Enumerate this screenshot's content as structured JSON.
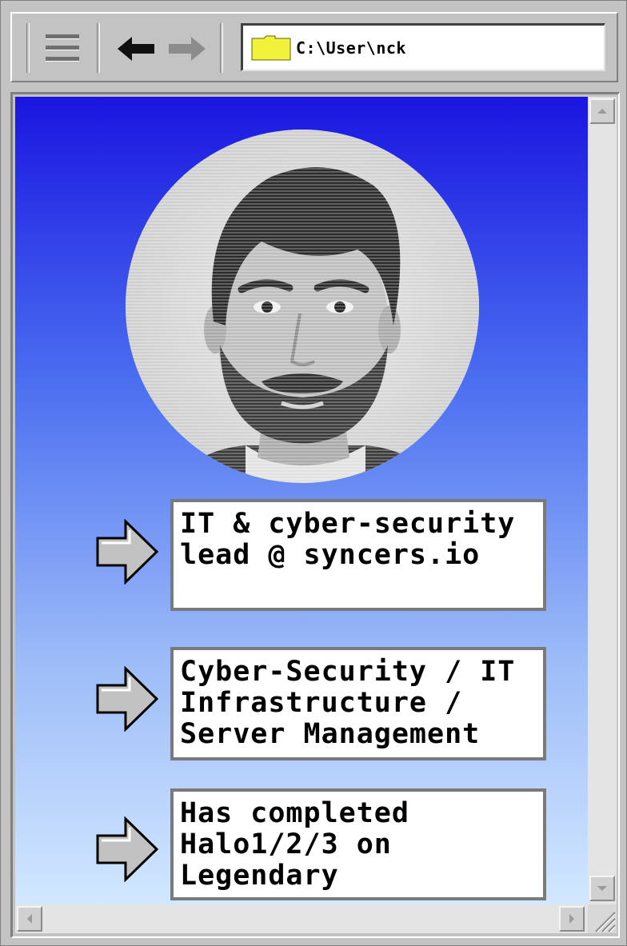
{
  "address_bar": {
    "path": "C:\\User\\nck"
  },
  "toolbar": {
    "menu_icon": "hamburger-menu-icon",
    "back_icon": "arrow-left-icon",
    "forward_icon": "arrow-right-icon",
    "folder_icon": "folder-icon",
    "folder_color": "#f2f23c"
  },
  "profile": {
    "photo": "profile-photo"
  },
  "cards": [
    {
      "text": "IT & cyber-security\nlead @ syncers.io"
    },
    {
      "text": "Cyber-Security / IT\nInfrastructure /\nServer Management"
    },
    {
      "text": "Has completed\nHalo1/2/3 on Legendary"
    }
  ],
  "colors": {
    "gradient_top": "#1a15e0",
    "gradient_bottom": "#d2e8ff",
    "chrome": "#c3c3c3"
  }
}
